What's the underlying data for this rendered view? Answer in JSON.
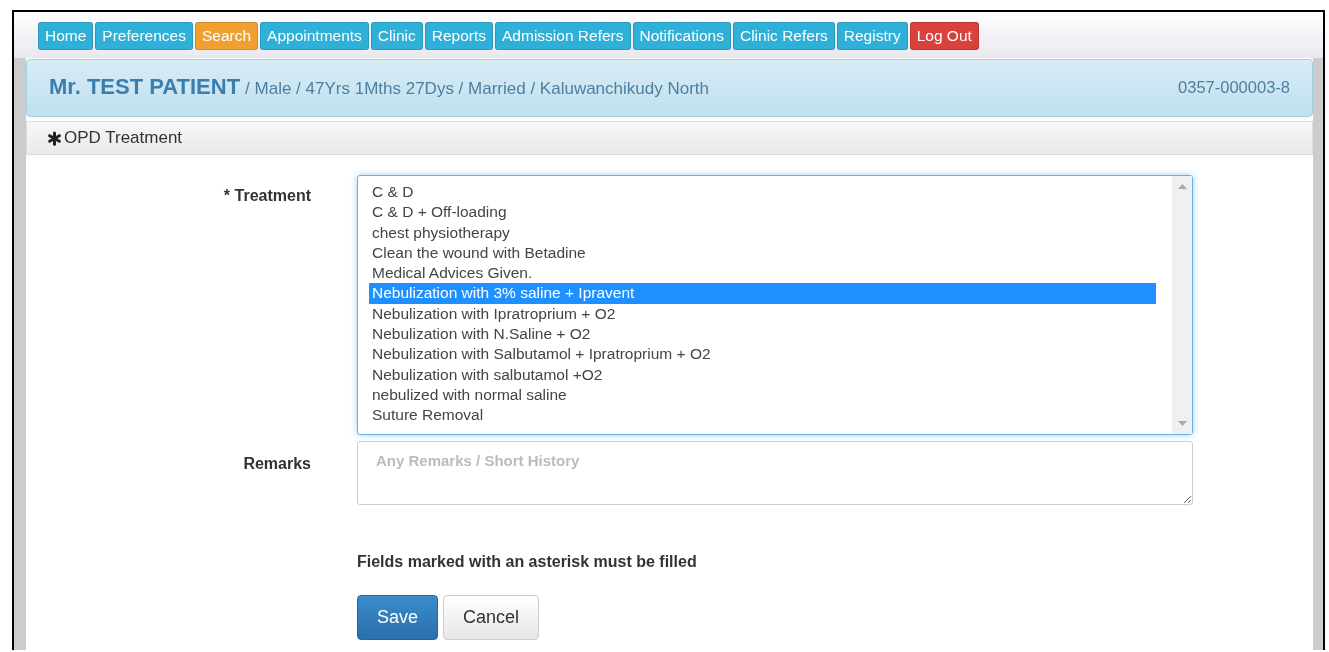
{
  "nav_tabs": [
    {
      "label": "Home",
      "kind": "link",
      "selected": false
    },
    {
      "label": "Preferences",
      "kind": "link",
      "selected": false
    },
    {
      "label": "Search",
      "kind": "link",
      "selected": true
    },
    {
      "label": "Appointments",
      "kind": "link",
      "selected": false
    },
    {
      "label": "Clinic",
      "kind": "link",
      "selected": false
    },
    {
      "label": "Reports",
      "kind": "link",
      "selected": false
    },
    {
      "label": "Admission Refers",
      "kind": "link",
      "selected": false
    },
    {
      "label": "Notifications",
      "kind": "link",
      "selected": false
    },
    {
      "label": "Clinic Refers",
      "kind": "link",
      "selected": false
    },
    {
      "label": "Registry",
      "kind": "link",
      "selected": false
    },
    {
      "label": "Log Out",
      "kind": "logout",
      "selected": false
    }
  ],
  "patient": {
    "name": "Mr. TEST PATIENT",
    "details": "/ Male / 47Yrs 1Mths 27Dys  / Married / Kaluwanchikudy North",
    "number": "0357-000003-8"
  },
  "section": {
    "title": "OPD Treatment"
  },
  "form": {
    "treatment_label": "* Treatment",
    "treatments": [
      {
        "label": "C & D",
        "selected": false
      },
      {
        "label": "C & D + Off-loading",
        "selected": false
      },
      {
        "label": "chest physiotherapy",
        "selected": false
      },
      {
        "label": "Clean the wound with Betadine",
        "selected": false
      },
      {
        "label": "Medical Advices Given.",
        "selected": false
      },
      {
        "label": "Nebulization with 3% saline + Ipravent",
        "selected": true
      },
      {
        "label": "Nebulization with Ipratroprium + O2",
        "selected": false
      },
      {
        "label": "Nebulization with N.Saline + O2",
        "selected": false
      },
      {
        "label": "Nebulization with Salbutamol + Ipratroprium + O2",
        "selected": false
      },
      {
        "label": "Nebulization with salbutamol +O2",
        "selected": false
      },
      {
        "label": "nebulized with normal saline",
        "selected": false
      },
      {
        "label": "Suture Removal",
        "selected": false
      }
    ],
    "remarks_label": "Remarks",
    "remarks_placeholder": "Any Remarks / Short History",
    "note": "Fields marked with an asterisk must be filled",
    "buttons": [
      {
        "label": "Save",
        "kind": "primary"
      },
      {
        "label": "Cancel",
        "kind": "default"
      }
    ]
  }
}
